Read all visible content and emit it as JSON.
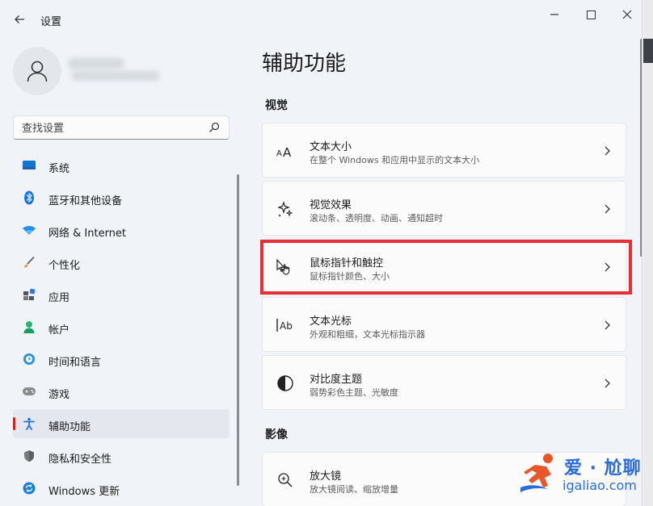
{
  "titlebar": {
    "back_icon": "arrow-left-icon",
    "title": "设置",
    "minimize_icon": "minimize-icon",
    "maximize_icon": "maximize-icon",
    "close_icon": "close-icon"
  },
  "profile": {
    "avatar_icon": "person-icon"
  },
  "search": {
    "placeholder": "查找设置",
    "icon": "search-icon"
  },
  "sidebar": {
    "items": [
      {
        "label": "系统",
        "icon": "monitor-icon",
        "active": false
      },
      {
        "label": "蓝牙和其他设备",
        "icon": "bluetooth-icon",
        "active": false
      },
      {
        "label": "网络 & Internet",
        "icon": "wifi-icon",
        "active": false
      },
      {
        "label": "个性化",
        "icon": "brush-icon",
        "active": false
      },
      {
        "label": "应用",
        "icon": "apps-icon",
        "active": false
      },
      {
        "label": "帐户",
        "icon": "account-icon",
        "active": false
      },
      {
        "label": "时间和语言",
        "icon": "globe-clock-icon",
        "active": false
      },
      {
        "label": "游戏",
        "icon": "gamepad-icon",
        "active": false
      },
      {
        "label": "辅助功能",
        "icon": "accessibility-icon",
        "active": true
      },
      {
        "label": "隐私和安全性",
        "icon": "shield-icon",
        "active": false
      },
      {
        "label": "Windows 更新",
        "icon": "update-icon",
        "active": false
      }
    ]
  },
  "main": {
    "title": "辅助功能",
    "sections": [
      {
        "title": "视觉",
        "cards": [
          {
            "title": "文本大小",
            "subtitle": "在整个 Windows 和应用中显示的文本大小",
            "icon": "text-size-icon"
          },
          {
            "title": "视觉效果",
            "subtitle": "滚动条、透明度、动画、通知超时",
            "icon": "sparkle-icon"
          },
          {
            "title": "鼠标指针和触控",
            "subtitle": "鼠标指针颜色、大小",
            "icon": "pointer-touch-icon"
          },
          {
            "title": "文本光标",
            "subtitle": "外观和粗细，文本光标指示器",
            "icon": "text-cursor-icon"
          },
          {
            "title": "对比度主题",
            "subtitle": "弱势彩色主题、光敏度",
            "icon": "contrast-icon"
          }
        ]
      },
      {
        "title": "影像",
        "cards": [
          {
            "title": "放大镜",
            "subtitle": "放大镜阅读、缩放增量",
            "icon": "magnifier-icon"
          }
        ]
      }
    ]
  },
  "watermark": {
    "main_text": "爱 · 尬聊",
    "sub_text": "igaliao.com",
    "icon": "runner-logo-icon"
  },
  "colors": {
    "accent": "#c42b1c",
    "highlight_box": "#e52e36",
    "watermark_blue": "#2a6bd6",
    "bluetooth": "#1a73e8"
  }
}
